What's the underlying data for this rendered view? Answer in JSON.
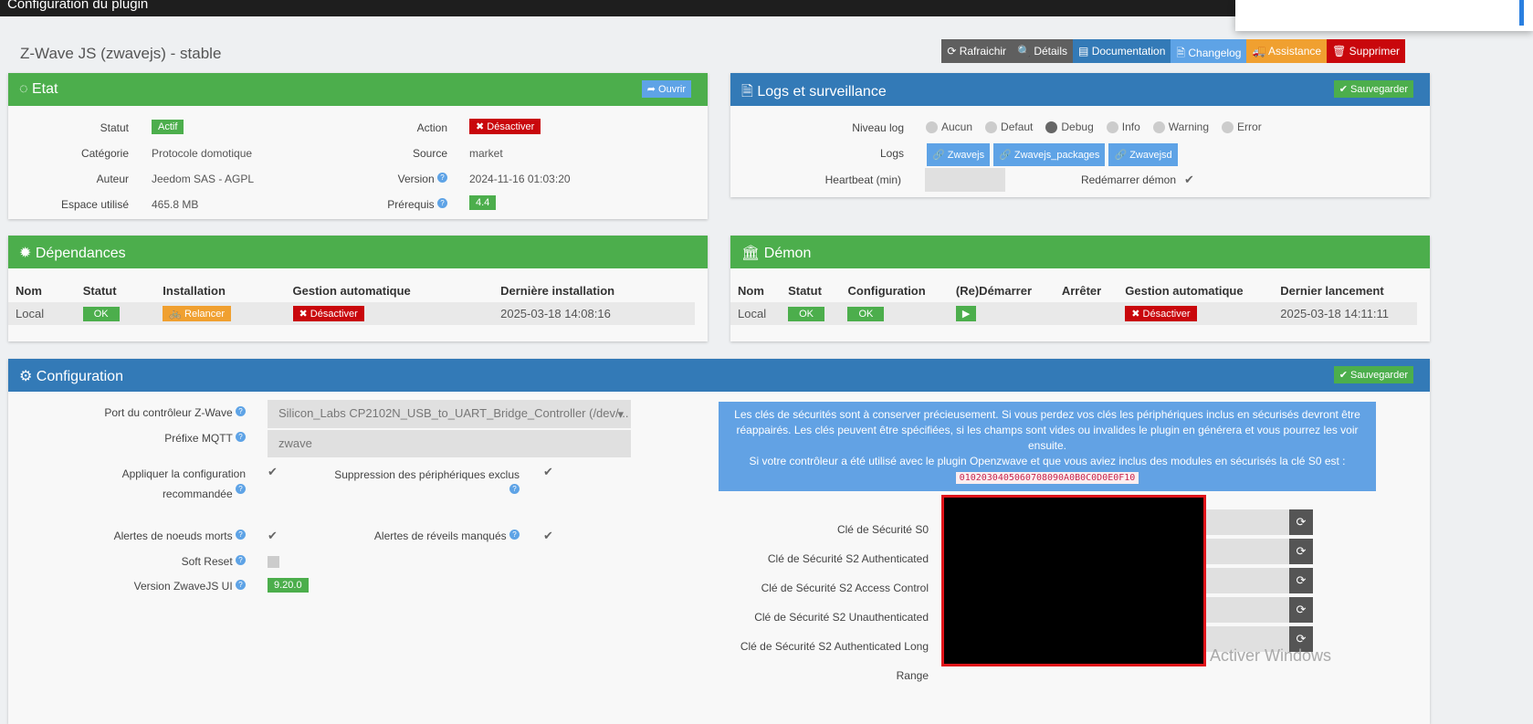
{
  "window_title": "Configuration du plugin",
  "plugin_title": "Z-Wave JS (zwavejs) - stable",
  "toolbar": [
    {
      "label": "⟳ Rafraichir",
      "color": "#5f5f5f"
    },
    {
      "label": "🔍 Détails",
      "color": "#5f5f5f"
    },
    {
      "label": "▤ Documentation",
      "color": "#337ab7"
    },
    {
      "label": "🗎 Changelog",
      "color": "#5ea3e6"
    },
    {
      "label": "🚚 Assistance",
      "color": "#f0a030"
    },
    {
      "label": "🗑 Supprimer",
      "color": "#c9070c"
    }
  ],
  "etat": {
    "title": "Etat",
    "open": "➦ Ouvrir",
    "statut_l": "Statut",
    "statut": "Actif",
    "cat_l": "Catégorie",
    "cat": "Protocole domotique",
    "auteur_l": "Auteur",
    "auteur": "Jeedom SAS - AGPL",
    "espace_l": "Espace utilisé",
    "espace": "465.8 MB",
    "action_l": "Action",
    "action": "✖ Désactiver",
    "source_l": "Source",
    "source": "market",
    "version_l": "Version",
    "version": "2024-11-16 01:03:20",
    "prereq_l": "Prérequis",
    "prereq": "4.4"
  },
  "logs": {
    "title": "Logs et surveillance",
    "save": "✔ Sauvegarder",
    "niveau_l": "Niveau log",
    "levels": [
      "Aucun",
      "Defaut",
      "Debug",
      "Info",
      "Warning",
      "Error"
    ],
    "logs_l": "Logs",
    "files": [
      "Zwavejs",
      "Zwavejs_packages",
      "Zwavejsd"
    ],
    "heartbeat_l": "Heartbeat (min)",
    "restart_l": "Redémarrer démon"
  },
  "deps": {
    "title": "Dépendances",
    "headers": [
      "Nom",
      "Statut",
      "Installation",
      "Gestion automatique",
      "Dernière installation"
    ],
    "row": {
      "nom": "Local",
      "statut": "OK",
      "install": "🚲 Relancer",
      "auto": "✖ Désactiver",
      "date": "2025-03-18 14:08:16"
    }
  },
  "demon": {
    "title": "Démon",
    "headers": [
      "Nom",
      "Statut",
      "Configuration",
      "(Re)Démarrer",
      "Arrêter",
      "Gestion automatique",
      "Dernier lancement"
    ],
    "row": {
      "nom": "Local",
      "statut": "OK",
      "config": "OK",
      "start": "▶",
      "auto": "✖ Désactiver",
      "date": "2025-03-18 14:11:11"
    }
  },
  "config": {
    "title": "Configuration",
    "save": "✔ Sauvegarder",
    "port_l": "Port du contrôleur Z-Wave",
    "port": "Silicon_Labs CP2102N_USB_to_UART_Bridge_Controller (/dev/...",
    "mqtt_l": "Préfixe MQTT",
    "mqtt": "zwave",
    "apply_l": "Appliquer la configuration recommandée",
    "supp_l": "Suppression des périphériques exclus",
    "dead_l": "Alertes de noeuds morts",
    "wake_l": "Alertes de réveils manqués",
    "soft_l": "Soft Reset",
    "ui_l": "Version ZwaveJS UI",
    "ui": "9.20.0",
    "info1": "Les clés de sécurités sont à conserver précieusement. Si vous perdez vos clés les périphériques inclus en sécurisés devront être réappairés. Les clés peuvent être spécifiées, si les champs sont vides ou invalides le plugin en générera et vous pourrez les voir ensuite.",
    "info2": "Si votre contrôleur a été utilisé avec le plugin Openzwave et que vous aviez inclus des modules en sécurisés la clé S0 est :",
    "s0": "0102030405060708090A0B0C0D0E0F10",
    "keys": [
      "Clé de Sécurité S0",
      "Clé de Sécurité S2 Authenticated",
      "Clé de Sécurité S2 Access Control",
      "Clé de Sécurité S2 Unauthenticated",
      "Clé de Sécurité S2 Authenticated Long Range"
    ]
  },
  "watermark": "Activer Windows"
}
